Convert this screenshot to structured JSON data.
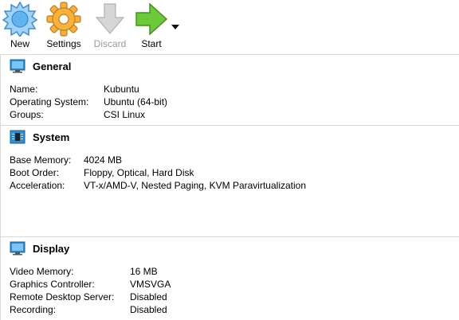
{
  "toolbar": {
    "new_label": "New",
    "settings_label": "Settings",
    "discard_label": "Discard",
    "start_label": "Start"
  },
  "general": {
    "title": "General",
    "rows": [
      {
        "key": "Name:",
        "value": "Kubuntu"
      },
      {
        "key": "Operating System:",
        "value": "Ubuntu (64-bit)"
      },
      {
        "key": "Groups:",
        "value": "CSI Linux"
      }
    ]
  },
  "system": {
    "title": "System",
    "rows": [
      {
        "key": "Base Memory:",
        "value": "4024 MB"
      },
      {
        "key": "Boot Order:",
        "value": "Floppy, Optical, Hard Disk"
      },
      {
        "key": "Acceleration:",
        "value": "VT-x/AMD-V, Nested Paging, KVM Paravirtualization"
      }
    ]
  },
  "display": {
    "title": "Display",
    "rows": [
      {
        "key": "Video Memory:",
        "value": "16 MB"
      },
      {
        "key": "Graphics Controller:",
        "value": "VMSVGA"
      },
      {
        "key": "Remote Desktop Server:",
        "value": "Disabled"
      },
      {
        "key": "Recording:",
        "value": "Disabled"
      }
    ]
  },
  "colors": {
    "new_icon": "#4aa3e8",
    "settings_icon": "#f3a735",
    "discard_icon": "#c9c9c9",
    "start_icon": "#5cbf2a",
    "section_icon": "#2b8fd6"
  }
}
